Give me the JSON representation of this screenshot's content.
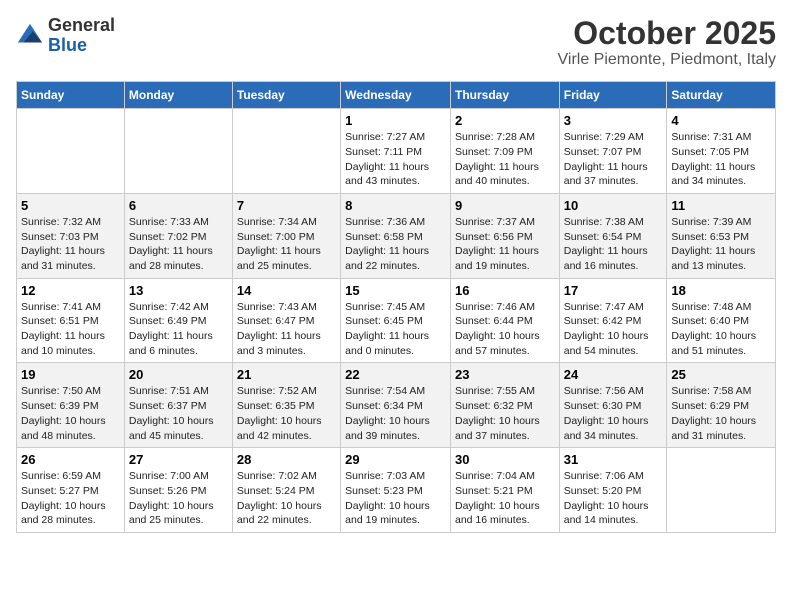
{
  "header": {
    "logo_line1": "General",
    "logo_line2": "Blue",
    "title": "October 2025",
    "subtitle": "Virle Piemonte, Piedmont, Italy"
  },
  "days_of_week": [
    "Sunday",
    "Monday",
    "Tuesday",
    "Wednesday",
    "Thursday",
    "Friday",
    "Saturday"
  ],
  "weeks": [
    [
      {
        "num": "",
        "info": ""
      },
      {
        "num": "",
        "info": ""
      },
      {
        "num": "",
        "info": ""
      },
      {
        "num": "1",
        "info": "Sunrise: 7:27 AM\nSunset: 7:11 PM\nDaylight: 11 hours and 43 minutes."
      },
      {
        "num": "2",
        "info": "Sunrise: 7:28 AM\nSunset: 7:09 PM\nDaylight: 11 hours and 40 minutes."
      },
      {
        "num": "3",
        "info": "Sunrise: 7:29 AM\nSunset: 7:07 PM\nDaylight: 11 hours and 37 minutes."
      },
      {
        "num": "4",
        "info": "Sunrise: 7:31 AM\nSunset: 7:05 PM\nDaylight: 11 hours and 34 minutes."
      }
    ],
    [
      {
        "num": "5",
        "info": "Sunrise: 7:32 AM\nSunset: 7:03 PM\nDaylight: 11 hours and 31 minutes."
      },
      {
        "num": "6",
        "info": "Sunrise: 7:33 AM\nSunset: 7:02 PM\nDaylight: 11 hours and 28 minutes."
      },
      {
        "num": "7",
        "info": "Sunrise: 7:34 AM\nSunset: 7:00 PM\nDaylight: 11 hours and 25 minutes."
      },
      {
        "num": "8",
        "info": "Sunrise: 7:36 AM\nSunset: 6:58 PM\nDaylight: 11 hours and 22 minutes."
      },
      {
        "num": "9",
        "info": "Sunrise: 7:37 AM\nSunset: 6:56 PM\nDaylight: 11 hours and 19 minutes."
      },
      {
        "num": "10",
        "info": "Sunrise: 7:38 AM\nSunset: 6:54 PM\nDaylight: 11 hours and 16 minutes."
      },
      {
        "num": "11",
        "info": "Sunrise: 7:39 AM\nSunset: 6:53 PM\nDaylight: 11 hours and 13 minutes."
      }
    ],
    [
      {
        "num": "12",
        "info": "Sunrise: 7:41 AM\nSunset: 6:51 PM\nDaylight: 11 hours and 10 minutes."
      },
      {
        "num": "13",
        "info": "Sunrise: 7:42 AM\nSunset: 6:49 PM\nDaylight: 11 hours and 6 minutes."
      },
      {
        "num": "14",
        "info": "Sunrise: 7:43 AM\nSunset: 6:47 PM\nDaylight: 11 hours and 3 minutes."
      },
      {
        "num": "15",
        "info": "Sunrise: 7:45 AM\nSunset: 6:45 PM\nDaylight: 11 hours and 0 minutes."
      },
      {
        "num": "16",
        "info": "Sunrise: 7:46 AM\nSunset: 6:44 PM\nDaylight: 10 hours and 57 minutes."
      },
      {
        "num": "17",
        "info": "Sunrise: 7:47 AM\nSunset: 6:42 PM\nDaylight: 10 hours and 54 minutes."
      },
      {
        "num": "18",
        "info": "Sunrise: 7:48 AM\nSunset: 6:40 PM\nDaylight: 10 hours and 51 minutes."
      }
    ],
    [
      {
        "num": "19",
        "info": "Sunrise: 7:50 AM\nSunset: 6:39 PM\nDaylight: 10 hours and 48 minutes."
      },
      {
        "num": "20",
        "info": "Sunrise: 7:51 AM\nSunset: 6:37 PM\nDaylight: 10 hours and 45 minutes."
      },
      {
        "num": "21",
        "info": "Sunrise: 7:52 AM\nSunset: 6:35 PM\nDaylight: 10 hours and 42 minutes."
      },
      {
        "num": "22",
        "info": "Sunrise: 7:54 AM\nSunset: 6:34 PM\nDaylight: 10 hours and 39 minutes."
      },
      {
        "num": "23",
        "info": "Sunrise: 7:55 AM\nSunset: 6:32 PM\nDaylight: 10 hours and 37 minutes."
      },
      {
        "num": "24",
        "info": "Sunrise: 7:56 AM\nSunset: 6:30 PM\nDaylight: 10 hours and 34 minutes."
      },
      {
        "num": "25",
        "info": "Sunrise: 7:58 AM\nSunset: 6:29 PM\nDaylight: 10 hours and 31 minutes."
      }
    ],
    [
      {
        "num": "26",
        "info": "Sunrise: 6:59 AM\nSunset: 5:27 PM\nDaylight: 10 hours and 28 minutes."
      },
      {
        "num": "27",
        "info": "Sunrise: 7:00 AM\nSunset: 5:26 PM\nDaylight: 10 hours and 25 minutes."
      },
      {
        "num": "28",
        "info": "Sunrise: 7:02 AM\nSunset: 5:24 PM\nDaylight: 10 hours and 22 minutes."
      },
      {
        "num": "29",
        "info": "Sunrise: 7:03 AM\nSunset: 5:23 PM\nDaylight: 10 hours and 19 minutes."
      },
      {
        "num": "30",
        "info": "Sunrise: 7:04 AM\nSunset: 5:21 PM\nDaylight: 10 hours and 16 minutes."
      },
      {
        "num": "31",
        "info": "Sunrise: 7:06 AM\nSunset: 5:20 PM\nDaylight: 10 hours and 14 minutes."
      },
      {
        "num": "",
        "info": ""
      }
    ]
  ]
}
